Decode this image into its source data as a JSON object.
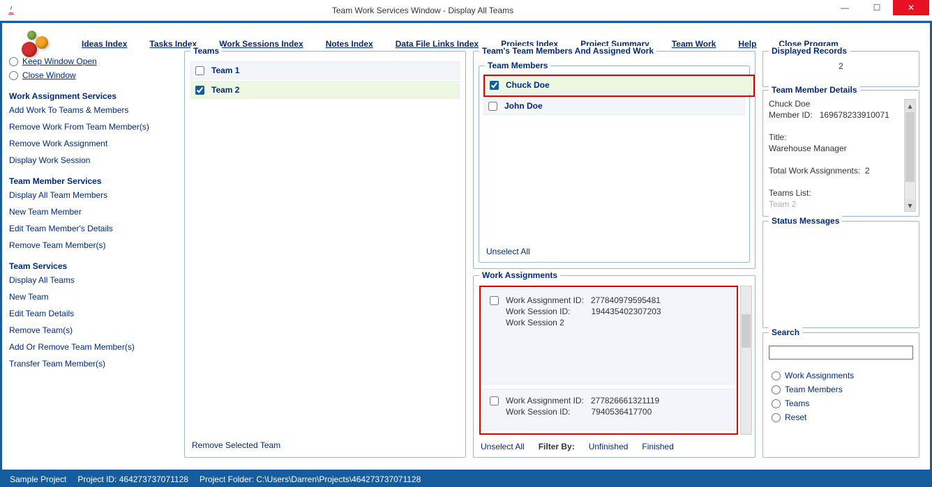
{
  "window": {
    "title": "Team Work Services Window - Display All Teams"
  },
  "menu": {
    "ideas": "Ideas Index",
    "tasks": "Tasks Index",
    "sessions": "Work Sessions Index",
    "notes": "Notes Index",
    "files": "Data File Links Index",
    "projects": "Projects Index",
    "summary": "Project Summary",
    "teamwork": "Team Work",
    "help": "Help",
    "close": "Close Program"
  },
  "sidebar": {
    "keep_open": "Keep Window Open",
    "close_win": "Close Window",
    "section1": "Work Assignment Services",
    "s1a": "Add Work To Teams & Members",
    "s1b": "Remove Work From Team Member(s)",
    "s1c": "Remove Work Assignment",
    "s1d": "Display Work Session",
    "section2": "Team Member Services",
    "s2a": "Display All Team Members",
    "s2b": "New Team Member",
    "s2c": "Edit Team Member's Details",
    "s2d": "Remove Team Member(s)",
    "section3": "Team Services",
    "s3a": "Display All Teams",
    "s3b": "New Team",
    "s3c": "Edit Team Details",
    "s3d": "Remove Team(s)",
    "s3e": "Add Or Remove Team Member(s)",
    "s3f": "Transfer Team Member(s)"
  },
  "teams": {
    "legend": "Teams",
    "rows": [
      {
        "name": "Team 1",
        "checked": false,
        "selected": false
      },
      {
        "name": "Team 2",
        "checked": true,
        "selected": true
      }
    ],
    "remove": "Remove Selected Team"
  },
  "membersGroup": {
    "legend": "Team's Team Members And Assigned Work"
  },
  "members": {
    "legend": "Team Members",
    "rows": [
      {
        "name": "Chuck Doe",
        "checked": true,
        "selected": true,
        "hi": true
      },
      {
        "name": "John Doe",
        "checked": false,
        "selected": false,
        "hi": false
      }
    ],
    "unselect": "Unselect All"
  },
  "work": {
    "legend": "Work Assignments",
    "items": [
      {
        "waId": "277840979595481",
        "wsId": "194435402307203",
        "wsName": "Work Session 2"
      },
      {
        "waId": "277826661321119",
        "wsId": "7940536417700",
        "wsName": ""
      }
    ],
    "labels": {
      "wa": "Work Assignment ID:",
      "ws": "Work Session ID:"
    },
    "unselect": "Unselect All",
    "filter_by": "Filter By:",
    "unfinished": "Unfinished",
    "finished": "Finished"
  },
  "displayed": {
    "legend": "Displayed Records",
    "value": "2"
  },
  "details": {
    "legend": "Team Member Details",
    "name": "Chuck Doe",
    "id_label": "Member ID:",
    "id": "169678233910071",
    "title_label": "Title:",
    "title": "Warehouse Manager",
    "twa_label": "Total Work Assignments:",
    "twa": "2",
    "teams_label": "Teams List:",
    "teams_cut": "Team 2"
  },
  "status": {
    "legend": "Status Messages"
  },
  "search": {
    "legend": "Search",
    "opt1": "Work Assignments",
    "opt2": "Team Members",
    "opt3": "Teams",
    "opt4": "Reset"
  },
  "statusbar": {
    "project": "Sample Project",
    "pid_label": "Project ID:",
    "pid": "464273737071128",
    "folder_label": "Project Folder:",
    "folder": "C:\\Users\\Darren\\Projects\\464273737071128"
  }
}
